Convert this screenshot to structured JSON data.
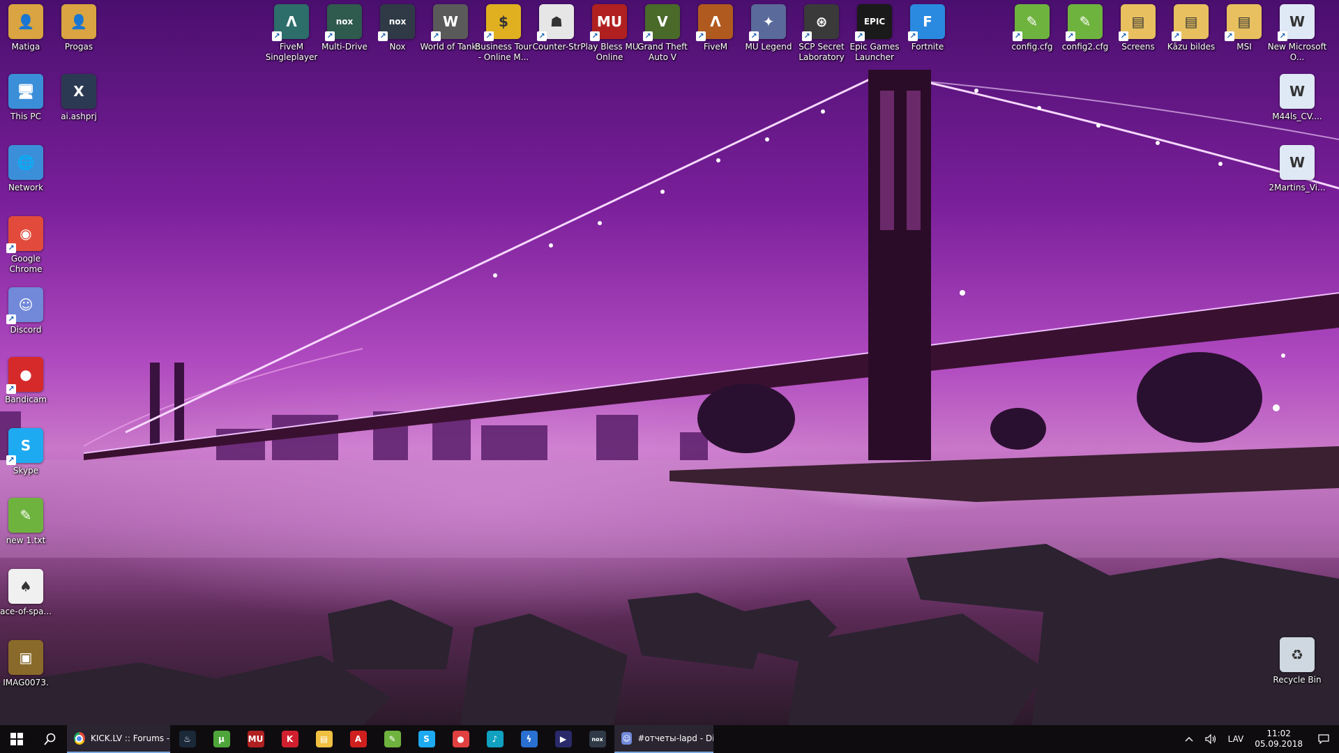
{
  "desktop": {
    "left_icons": [
      {
        "label": "Matiga",
        "icon": "folder-user-icon",
        "color": "#d9a441",
        "glyph": "👤",
        "shortcut": false
      },
      {
        "label": "Progas",
        "icon": "folder-user-icon",
        "color": "#d9a441",
        "glyph": "👤",
        "shortcut": false
      },
      {
        "label": "This PC",
        "icon": "computer-icon",
        "color": "#3b8fd9",
        "glyph": "🖥",
        "shortcut": false
      },
      {
        "label": "ai.ashprj",
        "icon": "ai-file-icon",
        "color": "#2b3a52",
        "glyph": "X",
        "shortcut": false
      },
      {
        "label": "Network",
        "icon": "network-icon",
        "color": "#3b8fd9",
        "glyph": "🌐",
        "shortcut": false
      },
      {
        "label": "Google Chrome",
        "icon": "chrome-icon",
        "color": "#e24b3b",
        "glyph": "◉",
        "shortcut": true
      },
      {
        "label": "Discord",
        "icon": "discord-icon",
        "color": "#7289da",
        "glyph": "☺",
        "shortcut": true
      },
      {
        "label": "Bandicam",
        "icon": "bandicam-icon",
        "color": "#d62a2a",
        "glyph": "●",
        "shortcut": true
      },
      {
        "label": "Skype",
        "icon": "skype-icon",
        "color": "#1eaaf1",
        "glyph": "S",
        "shortcut": true
      },
      {
        "label": "new 1.txt",
        "icon": "notepad-file-icon",
        "color": "#6fb33f",
        "glyph": "✎",
        "shortcut": false
      },
      {
        "label": "ace-of-spa...",
        "icon": "ace-of-spades-icon",
        "color": "#f0f0f0",
        "glyph": "♠",
        "shortcut": false
      },
      {
        "label": "IMAG0073.",
        "icon": "image-file-icon",
        "color": "#8a6a2a",
        "glyph": "▣",
        "shortcut": false
      }
    ],
    "top_icons": [
      {
        "label": "FiveM Singleplayer",
        "icon": "fivem-icon",
        "color": "#2d6d6a",
        "glyph": "Λ"
      },
      {
        "label": "Multi-Drive",
        "icon": "nox-multidrive-icon",
        "color": "#2f5a4e",
        "glyph": "nox"
      },
      {
        "label": "Nox",
        "icon": "nox-icon",
        "color": "#2f3a46",
        "glyph": "nox"
      },
      {
        "label": "World of Tanks",
        "icon": "world-of-tanks-icon",
        "color": "#5a5a5a",
        "glyph": "W"
      },
      {
        "label": "Business Tour - Online M...",
        "icon": "business-tour-icon",
        "color": "#e0b020",
        "glyph": "$"
      },
      {
        "label": "Counter-Str",
        "icon": "counter-strike-icon",
        "color": "#e6e6e6",
        "glyph": "☗"
      },
      {
        "label": "Play Bless MU Online",
        "icon": "mu-online-icon",
        "color": "#b02020",
        "glyph": "MU"
      },
      {
        "label": "Grand Theft Auto V",
        "icon": "gta-v-icon",
        "color": "#4a6a2a",
        "glyph": "V"
      },
      {
        "label": "FiveM",
        "icon": "fivem-icon",
        "color": "#b05a20",
        "glyph": "Λ"
      },
      {
        "label": "MU Legend",
        "icon": "mu-legend-icon",
        "color": "#5a6a9a",
        "glyph": "✦"
      },
      {
        "label": "SCP Secret Laboratory",
        "icon": "scp-icon",
        "color": "#3a3a3a",
        "glyph": "⊛"
      },
      {
        "label": "Epic Games Launcher",
        "icon": "epic-games-icon",
        "color": "#1a1a1a",
        "glyph": "EPIC"
      },
      {
        "label": "Fortnite",
        "icon": "fortnite-icon",
        "color": "#2a8ae0",
        "glyph": "F"
      },
      {
        "label": "config.cfg",
        "icon": "notepad-file-icon",
        "color": "#6fb33f",
        "glyph": "✎"
      },
      {
        "label": "config2.cfg",
        "icon": "notepad-file-icon",
        "color": "#6fb33f",
        "glyph": "✎"
      },
      {
        "label": "Screens",
        "icon": "folder-icon",
        "color": "#e8c060",
        "glyph": "▤"
      },
      {
        "label": "Kāzu bildes",
        "icon": "folder-icon",
        "color": "#e8c060",
        "glyph": "▤"
      },
      {
        "label": "MSI",
        "icon": "folder-icon",
        "color": "#e8c060",
        "glyph": "▤"
      },
      {
        "label": "New Microsoft O...",
        "icon": "word-file-icon",
        "color": "#dfe8f5",
        "glyph": "W"
      }
    ],
    "right_icons": [
      {
        "label": "M44ls_CV....",
        "icon": "word-file-icon",
        "color": "#dfe8f5",
        "glyph": "W"
      },
      {
        "label": "2Martins_Vi...",
        "icon": "word-file-icon",
        "color": "#dfe8f5",
        "glyph": "W"
      },
      {
        "label": "Recycle Bin",
        "icon": "recycle-bin-icon",
        "color": "#cfd8e0",
        "glyph": "♻"
      }
    ]
  },
  "taskbar": {
    "start_icon": "windows-logo-icon",
    "search_icon": "search-icon",
    "chrome_window_title": "KICK.LV :: Forums - ...",
    "pinned": [
      {
        "name": "steam-icon",
        "color": "#1b2838",
        "glyph": "♨"
      },
      {
        "name": "utorrent-icon",
        "color": "#4ea53a",
        "glyph": "µ"
      },
      {
        "name": "mu-online-icon",
        "color": "#b02020",
        "glyph": "MU"
      },
      {
        "name": "kaspersky-icon",
        "color": "#d02030",
        "glyph": "K"
      },
      {
        "name": "file-explorer-icon",
        "color": "#f0c040",
        "glyph": "▤"
      },
      {
        "name": "acrobat-icon",
        "color": "#d01f1f",
        "glyph": "A"
      },
      {
        "name": "notepad-plus-icon",
        "color": "#6fb33f",
        "glyph": "✎"
      },
      {
        "name": "skype-icon",
        "color": "#1eaaf1",
        "glyph": "S"
      },
      {
        "name": "bandicam-icon",
        "color": "#e04040",
        "glyph": "●"
      },
      {
        "name": "music-player-icon",
        "color": "#10a0c0",
        "glyph": "♪"
      },
      {
        "name": "thunderbolt-icon",
        "color": "#2a70d0",
        "glyph": "ϟ"
      },
      {
        "name": "media-player-icon",
        "color": "#2a2a6a",
        "glyph": "▶"
      },
      {
        "name": "nox-icon",
        "color": "#2f3a46",
        "glyph": "nox"
      }
    ],
    "discord_window_title": "#отчеты-lapd - Dis...",
    "tray": {
      "chevron_icon": "chevron-up-icon",
      "volume_icon": "volume-icon",
      "language": "LAV",
      "time": "11:02",
      "date": "05.09.2018",
      "notifications_icon": "notifications-icon"
    }
  }
}
